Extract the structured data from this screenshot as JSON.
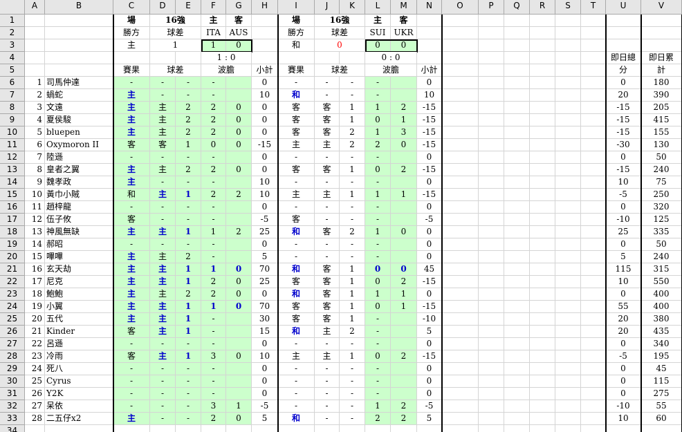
{
  "columns": [
    "A",
    "B",
    "C",
    "D",
    "E",
    "F",
    "G",
    "H",
    "I",
    "J",
    "K",
    "L",
    "M",
    "N",
    "O",
    "P",
    "Q",
    "R",
    "S",
    "T",
    "U",
    "V"
  ],
  "header_rows": [
    {
      "row": "1",
      "cells": {
        "C": "場",
        "D": "16強",
        "F": "主",
        "G": "客",
        "I": "場",
        "J": "16強",
        "L": "主",
        "M": "客"
      }
    },
    {
      "row": "2",
      "cells": {
        "C": "勝方",
        "D": "球差",
        "F": "ITA",
        "G": "AUS",
        "I": "勝方",
        "J": "球差",
        "L": "SUI",
        "M": "UKR"
      }
    },
    {
      "row": "3",
      "cells": {
        "C": "主",
        "D": "1",
        "F": "1",
        "G": "0",
        "I": "和",
        "J": "0",
        "L": "0",
        "M": "0"
      }
    },
    {
      "row": "4",
      "cells": {
        "F": "1 : 0",
        "L": "0 : 0",
        "U": "即日總"
      }
    },
    {
      "row": "5",
      "cells": {
        "C": "賽果",
        "D": "球差",
        "F": "波膽",
        "H": "小計",
        "I": "賽果",
        "J": "球差",
        "L": "波膽",
        "N": "小計",
        "U": "分",
        "V": "計"
      }
    }
  ],
  "v4_label": "即日累",
  "players": [
    [
      "1",
      "司馬仲達",
      "-",
      "-",
      "-",
      "-",
      "",
      "0",
      "-",
      "-",
      "-",
      "-",
      "",
      "0",
      "0",
      "180"
    ],
    [
      "2",
      "蝸蛇",
      "主",
      "-",
      "-",
      "-",
      "",
      "10",
      "和",
      "-",
      "-",
      "-",
      "",
      "10",
      "20",
      "390"
    ],
    [
      "3",
      "文遠",
      "主",
      "主",
      "2",
      "2",
      "0",
      "0",
      "客",
      "客",
      "1",
      "1",
      "2",
      "-15",
      "-15",
      "205"
    ],
    [
      "4",
      "夏侯駿",
      "主",
      "主",
      "2",
      "2",
      "0",
      "0",
      "客",
      "客",
      "1",
      "0",
      "1",
      "-15",
      "-15",
      "415"
    ],
    [
      "5",
      "bluepen",
      "主",
      "主",
      "2",
      "2",
      "0",
      "0",
      "客",
      "客",
      "2",
      "1",
      "3",
      "-15",
      "-15",
      "155"
    ],
    [
      "6",
      "Oxymoron II",
      "客",
      "客",
      "1",
      "0",
      "0",
      "-15",
      "主",
      "主",
      "2",
      "2",
      "0",
      "-15",
      "-30",
      "130"
    ],
    [
      "7",
      "陸遜",
      "-",
      "-",
      "-",
      "-",
      "",
      "0",
      "-",
      "-",
      "-",
      "-",
      "",
      "0",
      "0",
      "50"
    ],
    [
      "8",
      "皇者之翼",
      "主",
      "主",
      "2",
      "2",
      "0",
      "0",
      "客",
      "客",
      "1",
      "0",
      "2",
      "-15",
      "-15",
      "240"
    ],
    [
      "9",
      "魏孝政",
      "主",
      "-",
      "-",
      "-",
      "",
      "10",
      "-",
      "-",
      "-",
      "-",
      "",
      "0",
      "10",
      "75"
    ],
    [
      "10",
      "黃巾小賊",
      "和",
      "主",
      "1",
      "2",
      "2",
      "10",
      "主",
      "主",
      "1",
      "1",
      "1",
      "-15",
      "-5",
      "250"
    ],
    [
      "11",
      "趙梓龍",
      "-",
      "-",
      "-",
      "-",
      "",
      "0",
      "-",
      "-",
      "-",
      "-",
      "",
      "0",
      "0",
      "320"
    ],
    [
      "12",
      "伍子攸",
      "客",
      "-",
      "-",
      "-",
      "",
      "-5",
      "客",
      "-",
      "-",
      "-",
      "",
      "-5",
      "-10",
      "125"
    ],
    [
      "13",
      "神風無缺",
      "主",
      "主",
      "1",
      "1",
      "2",
      "25",
      "和",
      "客",
      "2",
      "1",
      "0",
      "0",
      "25",
      "335"
    ],
    [
      "14",
      "郝昭",
      "-",
      "-",
      "-",
      "-",
      "",
      "0",
      "-",
      "-",
      "-",
      "-",
      "",
      "0",
      "0",
      "50"
    ],
    [
      "15",
      "嗶嗶",
      "主",
      "主",
      "2",
      "-",
      "",
      "5",
      "-",
      "-",
      "-",
      "-",
      "",
      "0",
      "5",
      "240"
    ],
    [
      "16",
      "玄天劫",
      "主",
      "主",
      "1",
      "1",
      "0",
      "70",
      "和",
      "客",
      "1",
      "0",
      "0",
      "45",
      "115",
      "315"
    ],
    [
      "17",
      "尼克",
      "主",
      "主",
      "1",
      "2",
      "0",
      "25",
      "客",
      "客",
      "1",
      "0",
      "2",
      "-15",
      "10",
      "550"
    ],
    [
      "18",
      "鮑鮑",
      "主",
      "主",
      "2",
      "2",
      "0",
      "0",
      "和",
      "客",
      "1",
      "1",
      "1",
      "0",
      "0",
      "400"
    ],
    [
      "19",
      "小翼",
      "主",
      "主",
      "1",
      "1",
      "0",
      "70",
      "客",
      "客",
      "1",
      "0",
      "1",
      "-15",
      "55",
      "400"
    ],
    [
      "20",
      "五代",
      "主",
      "主",
      "1",
      "-",
      "",
      "30",
      "客",
      "客",
      "1",
      "-",
      "",
      "-10",
      "20",
      "380"
    ],
    [
      "21",
      "Kinder",
      "客",
      "主",
      "1",
      "-",
      "",
      "15",
      "和",
      "主",
      "2",
      "-",
      "",
      "5",
      "20",
      "435"
    ],
    [
      "22",
      "呂遜",
      "-",
      "-",
      "-",
      "-",
      "",
      "0",
      "-",
      "-",
      "-",
      "-",
      "",
      "0",
      "0",
      "340"
    ],
    [
      "23",
      "冷雨",
      "客",
      "主",
      "1",
      "3",
      "0",
      "10",
      "主",
      "主",
      "1",
      "0",
      "2",
      "-15",
      "-5",
      "195"
    ],
    [
      "24",
      "死八",
      "-",
      "-",
      "-",
      "-",
      "",
      "0",
      "-",
      "-",
      "-",
      "-",
      "",
      "0",
      "0",
      "45"
    ],
    [
      "25",
      "Cyrus",
      "-",
      "-",
      "-",
      "-",
      "",
      "0",
      "-",
      "-",
      "-",
      "-",
      "",
      "0",
      "0",
      "115"
    ],
    [
      "26",
      "Y2K",
      "-",
      "-",
      "-",
      "-",
      "",
      "0",
      "-",
      "-",
      "-",
      "-",
      "",
      "0",
      "0",
      "275"
    ],
    [
      "27",
      "呆依",
      "-",
      "-",
      "-",
      "3",
      "1",
      "-5",
      "-",
      "-",
      "-",
      "1",
      "2",
      "-5",
      "-10",
      "55"
    ],
    [
      "28",
      "二五仔x2",
      "主",
      "-",
      "-",
      "2",
      "0",
      "5",
      "和",
      "-",
      "-",
      "2",
      "2",
      "5",
      "10",
      "60"
    ]
  ],
  "blue_cells": [
    [
      2,
      "C"
    ],
    [
      2,
      "I"
    ],
    [
      3,
      "C"
    ],
    [
      4,
      "C"
    ],
    [
      5,
      "C"
    ],
    [
      8,
      "C"
    ],
    [
      9,
      "C"
    ],
    [
      10,
      "D"
    ],
    [
      10,
      "E"
    ],
    [
      13,
      "C"
    ],
    [
      13,
      "D"
    ],
    [
      13,
      "E"
    ],
    [
      13,
      "I"
    ],
    [
      15,
      "C"
    ],
    [
      16,
      "C"
    ],
    [
      16,
      "D"
    ],
    [
      16,
      "E"
    ],
    [
      16,
      "F"
    ],
    [
      16,
      "G"
    ],
    [
      16,
      "I"
    ],
    [
      16,
      "L"
    ],
    [
      16,
      "M"
    ],
    [
      17,
      "C"
    ],
    [
      17,
      "D"
    ],
    [
      17,
      "E"
    ],
    [
      18,
      "C"
    ],
    [
      18,
      "I"
    ],
    [
      19,
      "C"
    ],
    [
      19,
      "D"
    ],
    [
      19,
      "E"
    ],
    [
      19,
      "F"
    ],
    [
      19,
      "G"
    ],
    [
      20,
      "C"
    ],
    [
      20,
      "D"
    ],
    [
      20,
      "E"
    ],
    [
      21,
      "D"
    ],
    [
      21,
      "E"
    ],
    [
      21,
      "I"
    ],
    [
      23,
      "D"
    ],
    [
      23,
      "E"
    ],
    [
      28,
      "C"
    ],
    [
      28,
      "I"
    ]
  ],
  "colors": {
    "header_bg": "#e6e6e6",
    "green_fill": "#ccffcc",
    "blue_text": "#0000cc",
    "red_text": "#ff0000",
    "grid_line": "#d4d4d4"
  }
}
